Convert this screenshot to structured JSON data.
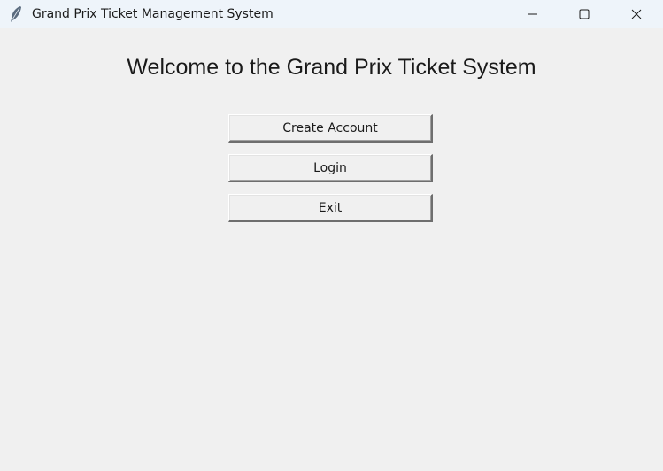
{
  "window": {
    "title": "Grand Prix Ticket Management System",
    "app_icon": "feather-icon",
    "controls": {
      "minimize_icon": "minimize-icon",
      "maximize_icon": "maximize-icon",
      "close_icon": "close-icon"
    }
  },
  "main": {
    "heading": "Welcome to the Grand Prix Ticket System",
    "buttons": {
      "create_account": "Create Account",
      "login": "Login",
      "exit": "Exit"
    }
  },
  "colors": {
    "titlebar": "#eef4fa",
    "background": "#f0f0f0",
    "text": "#1a1a1a"
  }
}
